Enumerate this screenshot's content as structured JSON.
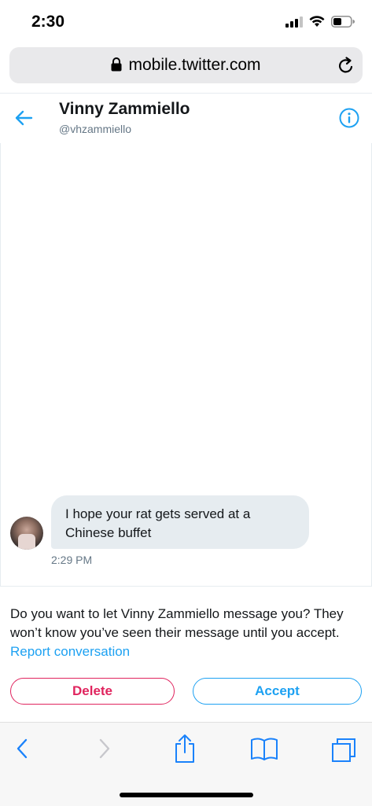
{
  "status_bar": {
    "time": "2:30"
  },
  "browser": {
    "url": "mobile.twitter.com"
  },
  "header": {
    "name": "Vinny Zammiello",
    "handle": "@vhzammiello"
  },
  "message": {
    "text": "I hope your rat gets served at a Chinese buffet",
    "time": "2:29 PM"
  },
  "request": {
    "prompt": "Do you want to let Vinny Zammiello message you? They won’t know you’ve seen their message until you accept. ",
    "report_label": "Report conversation",
    "delete_label": "Delete",
    "accept_label": "Accept"
  },
  "colors": {
    "accent": "#1da1f2",
    "danger": "#e0245e",
    "bubble": "#e6ecf0",
    "muted_text": "#657786"
  },
  "icons": {
    "back": "arrow-left-icon",
    "info": "info-icon",
    "lock": "lock-icon",
    "reload": "reload-icon",
    "toolbar": [
      "back-icon",
      "forward-icon",
      "share-icon",
      "bookmarks-icon",
      "tabs-icon"
    ]
  }
}
